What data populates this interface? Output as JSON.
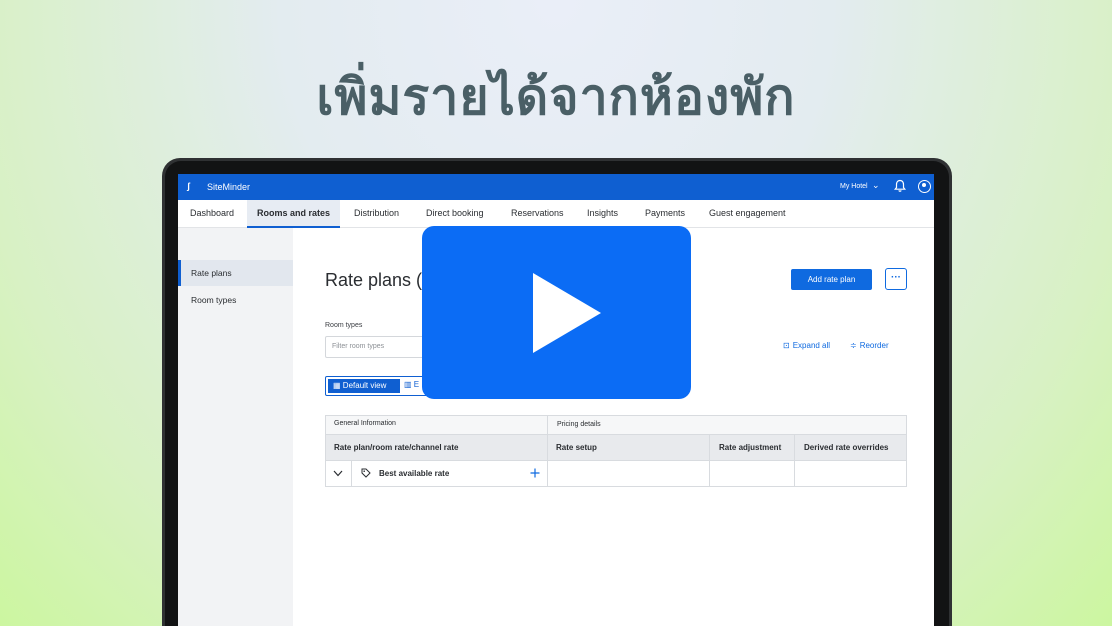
{
  "headline": "เพิ่มรายได้จากห้องพัก",
  "app": {
    "brand": "SiteMinder",
    "hotel_selector": "My Hotel"
  },
  "nav_tabs": [
    {
      "label": "Dashboard"
    },
    {
      "label": "Rooms and rates"
    },
    {
      "label": "Distribution"
    },
    {
      "label": "Direct booking"
    },
    {
      "label": "Reservations"
    },
    {
      "label": "Insights"
    },
    {
      "label": "Payments"
    },
    {
      "label": "Guest engagement"
    }
  ],
  "sidebar": {
    "items": [
      {
        "label": "Rate plans",
        "active": true
      },
      {
        "label": "Room types",
        "active": false
      }
    ]
  },
  "main": {
    "title": "Rate plans (",
    "add_button": "Add rate plan",
    "more_button": "···",
    "filter": {
      "label": "Room types",
      "placeholder": "Filter room types"
    },
    "expand_all": "Expand all",
    "reorder": "Reorder",
    "view_default": "Default view",
    "view_other": "E"
  },
  "table": {
    "groups": [
      "General Information",
      "Pricing details"
    ],
    "columns": [
      "Rate plan/room rate/channel rate",
      "Rate setup",
      "Rate adjustment",
      "Derived rate overrides"
    ],
    "rows": [
      {
        "name": "Best available rate",
        "expand_icon": "chevron-down",
        "tag_icon": "tag",
        "add_icon": "plus"
      }
    ]
  },
  "overlay": {
    "icon": "play-icon",
    "color": "#0b6cf5"
  },
  "colors": {
    "primary": "#0f5fd1",
    "headline": "#4a5f66"
  }
}
